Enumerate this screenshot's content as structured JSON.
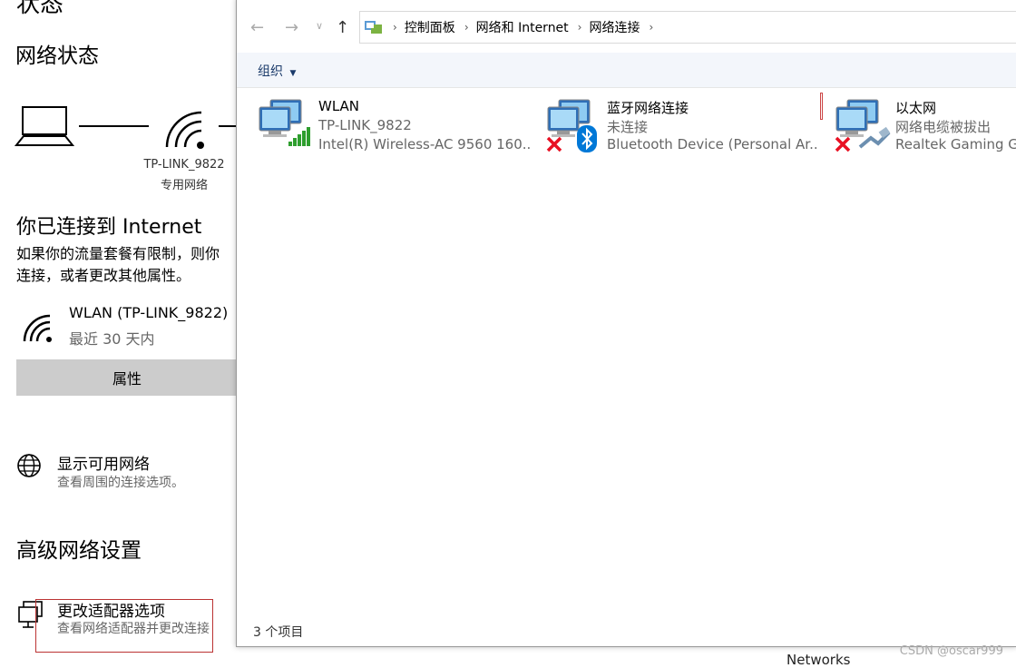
{
  "settings": {
    "title": "状态",
    "section_title": "网络状态",
    "network_name": "TP-LINK_9822",
    "network_type": "专用网络",
    "connected_heading": "你已连接到 Internet",
    "desc_line1": "如果你的流量套餐有限制，则你",
    "desc_line2": "连接，或者更改其他属性。",
    "wlan_label": "WLAN (TP-LINK_9822)",
    "wlan_usage": "最近 30 天内",
    "properties_button": "属性",
    "show_networks_title": "显示可用网络",
    "show_networks_sub": "查看周围的连接选项。",
    "advanced_heading": "高级网络设置",
    "adapter_title": "更改适配器选项",
    "adapter_sub": "查看网络适配器并更改连接"
  },
  "explorer": {
    "breadcrumb": [
      "控制面板",
      "网络和 Internet",
      "网络连接"
    ],
    "organize_label": "组织",
    "connections": [
      {
        "name": "WLAN",
        "line2": "TP-LINK_9822",
        "line3": "Intel(R) Wireless-AC 9560 160..."
      },
      {
        "name": "蓝牙网络连接",
        "line2": "未连接",
        "line3": "Bluetooth Device (Personal Ar..."
      },
      {
        "name": "以太网",
        "line2": "网络电缆被拔出",
        "line3": "Realtek Gaming Gb"
      }
    ],
    "status_bar": "3 个项目"
  },
  "behind": {
    "networks_text": "Networks"
  },
  "watermark": "CSDN @oscar999",
  "icons": [
    "laptop-icon",
    "wifi-icon",
    "globe-icon",
    "adapter-icon",
    "back-arrow-icon",
    "forward-arrow-icon",
    "up-arrow-icon",
    "network-folder-icon",
    "bluetooth-icon",
    "error-x-icon",
    "cable-icon",
    "signal-bars-icon"
  ],
  "colors": {
    "accent": "#0078d7",
    "error_red": "#e81123",
    "signal_green": "#2e9e2e"
  }
}
